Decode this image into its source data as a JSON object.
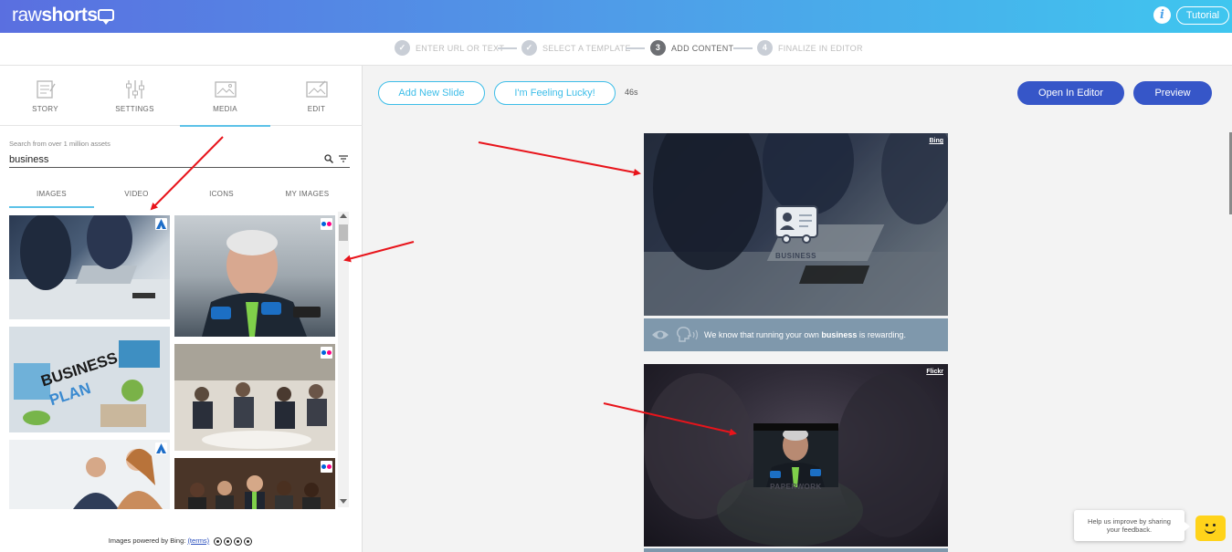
{
  "app": {
    "logo_part1": "raw",
    "logo_part2": "shorts",
    "info_icon_glyph": "i",
    "tutorial_label": "Tutorial"
  },
  "steps": [
    {
      "label": "ENTER URL OR TEXT",
      "state": "done"
    },
    {
      "label": "SELECT A TEMPLATE",
      "state": "done"
    },
    {
      "label": "ADD CONTENT",
      "state": "active",
      "number": "3"
    },
    {
      "label": "FINALIZE IN EDITOR",
      "state": "todo",
      "number": "4"
    }
  ],
  "left_tabs": [
    {
      "label": "STORY",
      "icon": "story-icon"
    },
    {
      "label": "SETTINGS",
      "icon": "sliders-icon"
    },
    {
      "label": "MEDIA",
      "icon": "image-icon",
      "active": true
    },
    {
      "label": "EDIT",
      "icon": "edit-image-icon"
    }
  ],
  "search": {
    "hint": "Search from over 1 million assets",
    "value": "business"
  },
  "media_tabs": [
    {
      "label": "IMAGES",
      "active": true
    },
    {
      "label": "VIDEO"
    },
    {
      "label": "ICONS"
    },
    {
      "label": "MY IMAGES"
    }
  ],
  "thumbnails": [
    {
      "subject": "business meeting laptop",
      "source": "bing"
    },
    {
      "subject": "man speaking at microphones",
      "source": "flickr"
    },
    {
      "subject": "business plan desk",
      "source": "none"
    },
    {
      "subject": "conference audience",
      "source": "flickr"
    },
    {
      "subject": "man and woman office",
      "source": "bing"
    },
    {
      "subject": "panel of people",
      "source": "flickr"
    }
  ],
  "powered_by": {
    "text": "Images powered by Bing:",
    "terms_link": "(terms)"
  },
  "toolbar": {
    "add_slide": "Add New Slide",
    "feeling_lucky": "I'm Feeling Lucky!",
    "duration": "46s",
    "open_editor": "Open In Editor",
    "preview": "Preview"
  },
  "slides": [
    {
      "credit": "Bing",
      "icon_label": "BUSINESS",
      "caption_before": "We know that running your own ",
      "caption_bold": "business",
      "caption_after": " is rewarding."
    },
    {
      "credit": "Flickr",
      "overlay_label": "PAPERWORK"
    }
  ],
  "feedback": {
    "line1": "Help us improve by sharing",
    "line2": "your feedback."
  },
  "colors": {
    "accent": "#3cbde8",
    "primary_button": "#3656c8",
    "caption_bg": "#7f98ac",
    "annotation_arrow": "#e8141b"
  }
}
